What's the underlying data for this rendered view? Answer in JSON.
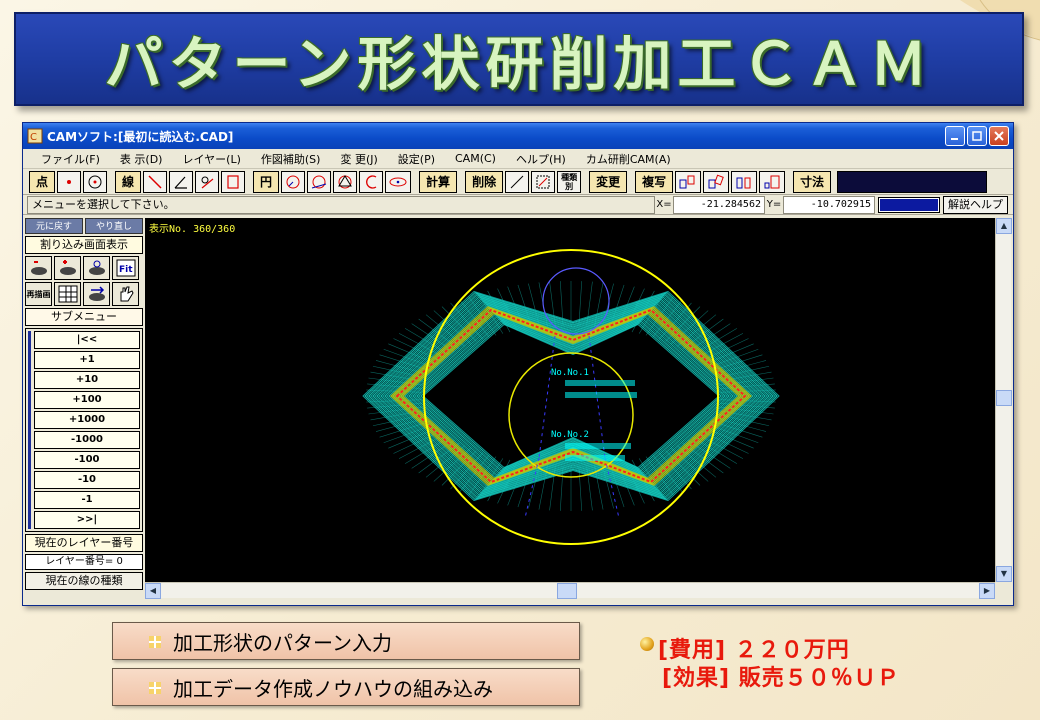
{
  "slide": {
    "title": "パターン形状研削加工ＣＡＭ"
  },
  "window": {
    "title": "CAMソフト:[最初に読込む.CAD]"
  },
  "menu": [
    "ファイル(F)",
    "表 示(D)",
    "レイヤー(L)",
    "作図補助(S)",
    "変 更(J)",
    "設定(P)",
    "CAM(C)",
    "ヘルプ(H)",
    "カム研削CAM(A)"
  ],
  "toolbar": {
    "point_label": "点",
    "line_label": "線",
    "circle_label": "円",
    "calc_label": "計算",
    "delete_label": "削除",
    "kind_label": "種類別",
    "change_label": "変更",
    "copy_label": "複写",
    "dimension_label": "寸法"
  },
  "status": {
    "message": "メニューを選択して下さい。",
    "x_label": "X=",
    "x_value": "-21.284562",
    "y_label": "Y=",
    "y_value": "-10.702915",
    "help_label": "解説ヘルプ"
  },
  "sidebar": {
    "undo_label": "元に戻す",
    "redo_label": "やり直し",
    "interrupt_label": "割り込み画面表示",
    "icons": [
      "zoom-out",
      "zoom-in",
      "zoom-prev",
      "fit",
      "redraw",
      "grid",
      "pan",
      "hand"
    ],
    "redraw_label": "再描画",
    "fit_label": "Fit",
    "submenu_label": "サブメニュー",
    "submenu_items": [
      "|<<",
      "+1",
      "+10",
      "+100",
      "+1000",
      "-1000",
      "-100",
      "-10",
      "-1",
      ">>|"
    ],
    "current_layer_label": "現在のレイヤー番号",
    "layer_number_label": "レイヤー番号= 0",
    "current_line_label": "現在の線の種類"
  },
  "canvas": {
    "display_count": "表示No. 360/360",
    "annotation_1": "No.No.1",
    "annotation_2": "No.No.2"
  },
  "features": [
    "加工形状のパターン入力",
    "加工データ作成ノウハウの組み込み"
  ],
  "cost": {
    "line1": "[費用] ２２０万円",
    "line2": "[効果] 販売５０％ＵＰ"
  }
}
